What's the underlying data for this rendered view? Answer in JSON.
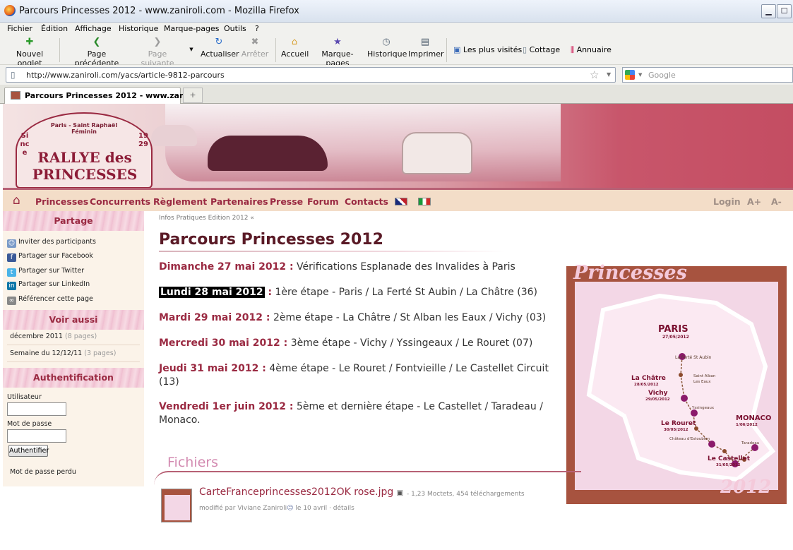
{
  "window": {
    "title": "Parcours Princesses 2012 - www.zaniroli.com - Mozilla Firefox",
    "minimize": "▁",
    "maximize": "☐"
  },
  "menu": [
    "Fichier",
    "Édition",
    "Affichage",
    "Historique",
    "Marque-pages",
    "Outils",
    "?"
  ],
  "toolbar": {
    "new_tab": "Nouvel onglet",
    "back": "Page précédente",
    "forward": "Page suivante",
    "reload": "Actualiser",
    "stop": "Arrêter",
    "home": "Accueil",
    "bookmarks": "Marque-pages",
    "history": "Historique",
    "print": "Imprimer",
    "most_visited": "Les plus visités",
    "cottage": "Cottage",
    "annuaire": "Annuaire"
  },
  "address": {
    "url": "http://www.zaniroli.com/yacs/article-9812-parcours",
    "search_placeholder": "Google"
  },
  "tab": {
    "title": "Parcours Princesses 2012 - www.zan...",
    "close": "×",
    "new": "+"
  },
  "banner": {
    "logo_top": "Paris - Saint Raphaël\nFéminin",
    "logo_main": "RALLYE des PRINCESSES",
    "since": "Since",
    "year": "1929"
  },
  "nav": {
    "items": [
      "Princesses",
      "Concurrents",
      "Règlement",
      "Partenaires",
      "Presse",
      "Forum",
      "Contacts"
    ],
    "login": "Login",
    "aplus": "A+",
    "aminus": "A-"
  },
  "sidebar": {
    "partage": {
      "title": "Partage",
      "items": [
        "Inviter des participants",
        "Partager sur Facebook",
        "Partager sur Twitter",
        "Partager sur LinkedIn",
        "Référencer cette page"
      ]
    },
    "voir_aussi": {
      "title": "Voir aussi",
      "items": [
        {
          "label": "décembre 2011",
          "count": "(8 pages)"
        },
        {
          "label": "Semaine du 12/12/11",
          "count": "(3 pages)"
        }
      ]
    },
    "auth": {
      "title": "Authentification",
      "user_label": "Utilisateur",
      "pass_label": "Mot de passe",
      "button": "Authentifier",
      "lost": "Mot de passe perdu"
    }
  },
  "main": {
    "breadcrumb": "Infos Pratiques Edition 2012 «",
    "title": "Parcours Princesses 2012",
    "days": [
      {
        "date": "Dimanche 27 mai 2012 :",
        "text": "Vérifications Esplanade des Invalides à Paris"
      },
      {
        "date": "Lundi 28 mai 2012",
        "colon": " :",
        "text": "1ère étape - Paris / La Ferté St Aubin / La Châtre (36)"
      },
      {
        "date": "Mardi 29 mai 2012 :",
        "text": "2ème étape - La Châtre / St Alban les Eaux / Vichy (03)"
      },
      {
        "date": "Mercredi 30 mai 2012 :",
        "text": "3ème étape - Vichy / Yssingeaux / Le Rouret (07)"
      },
      {
        "date": "Jeudi 31 mai 2012 :",
        "text": "4ème étape - Le Rouret / Fontvieille / Le Castellet Circuit (13)"
      },
      {
        "date": "Vendredi 1er juin 2012 :",
        "text": "5ème et dernière étape - Le Castellet / Taradeau / Monaco."
      }
    ],
    "map": {
      "title": "Princesses",
      "year": "2012",
      "stops": [
        {
          "name": "PARIS",
          "date": "27/05/2012"
        },
        {
          "name": "La Ferté St Aubin",
          "date": ""
        },
        {
          "name": "La Châtre",
          "date": "28/05/2012"
        },
        {
          "name": "Saint Alban\nLes Eaux",
          "date": ""
        },
        {
          "name": "Vichy",
          "date": "29/05/2012"
        },
        {
          "name": "Yssingeaux",
          "date": ""
        },
        {
          "name": "Le Rouret",
          "date": "30/05/2012"
        },
        {
          "name": "Château d'Estoublon",
          "date": ""
        },
        {
          "name": "Le Castellet",
          "date": "31/05/2012"
        },
        {
          "name": "Taradeau",
          "date": ""
        },
        {
          "name": "MONACO",
          "date": "1/06/2012"
        }
      ]
    },
    "files": {
      "heading": "Fichiers",
      "file_name": "CarteFranceprincesses2012OK rose.jpg",
      "meta": "- 1,23 Moctets, 454 téléchargements",
      "modified": "modifié par Viviane Zaniroli",
      "modified_date": "le 10 avril ·",
      "details": "détails"
    }
  },
  "colors": {
    "accent": "#9a2a42",
    "nav_bg": "#f3ddc8",
    "sidebar_bg": "#fbf3e9",
    "map_bg": "#a7533f"
  }
}
